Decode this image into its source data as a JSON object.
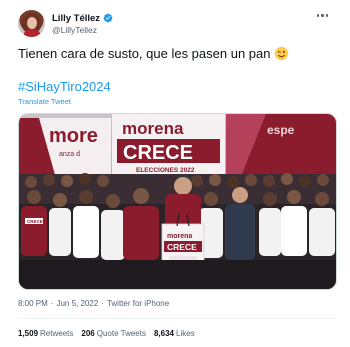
{
  "author": {
    "display_name": "Lilly Téllez",
    "handle": "@LillyTellez",
    "verified": true
  },
  "tweet": {
    "text": "Tienen cara de susto, que les pasen un pan",
    "emoji": "winking-face",
    "hashtag": "#SiHayTiro2024",
    "translate_label": "Translate Tweet"
  },
  "media": {
    "banner_left_text": "more",
    "banner_left_sub": "anza d",
    "banner_center_top": "morena",
    "banner_center_main": "CRECE",
    "banner_center_sub": "ELECCIONES 2022",
    "banner_right_text": "espe",
    "podium_top": "morena",
    "podium_main": "CRECE",
    "shirt_text": "CRECE"
  },
  "meta": {
    "time": "8:00 PM",
    "separator": "·",
    "date": "Jun 5, 2022",
    "source": "Twitter for iPhone"
  },
  "stats": {
    "retweets_count": "1,509",
    "retweets_label": "Retweets",
    "quotes_count": "206",
    "quotes_label": "Quote Tweets",
    "likes_count": "8,634",
    "likes_label": "Likes"
  },
  "colors": {
    "accent": "#1d9bf0",
    "brand_maroon": "#8a1c2e",
    "text": "#0f1419",
    "muted": "#536471"
  }
}
